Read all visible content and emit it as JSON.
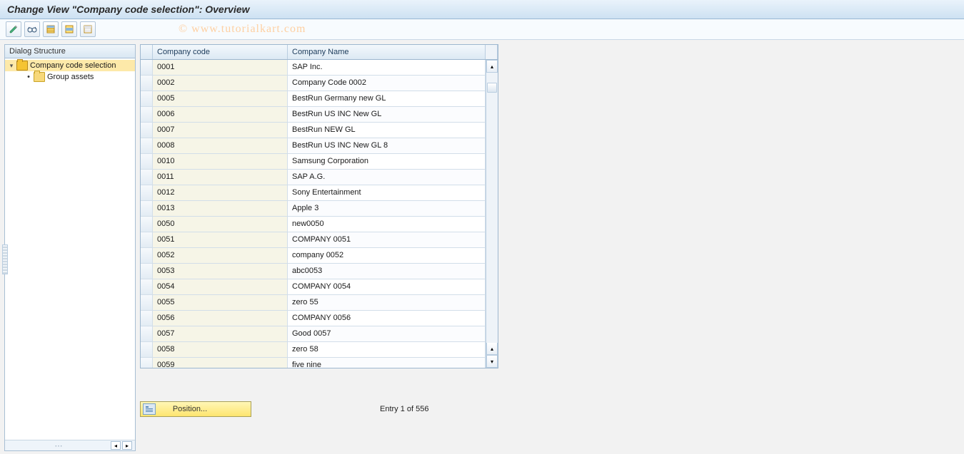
{
  "title": "Change View \"Company code selection\": Overview",
  "watermark": "© www.tutorialkart.com",
  "toolbar": {
    "btn1_tip": "Display/Change",
    "btn2_tip": "Change",
    "btn3_tip": "Select All",
    "btn4_tip": "Select Block",
    "btn5_tip": "Deselect All"
  },
  "dialog_structure": {
    "header": "Dialog Structure",
    "items": [
      {
        "label": "Company code selection",
        "selected": true,
        "expanded": true,
        "leaf": false
      },
      {
        "label": "Group assets",
        "selected": false,
        "expanded": false,
        "leaf": true
      }
    ]
  },
  "table": {
    "columns": {
      "code": "Company code",
      "name": "Company Name"
    },
    "rows": [
      {
        "code": "0001",
        "name": "SAP Inc."
      },
      {
        "code": "0002",
        "name": "Company Code 0002"
      },
      {
        "code": "0005",
        "name": "BestRun Germany new GL"
      },
      {
        "code": "0006",
        "name": "BestRun US INC New GL"
      },
      {
        "code": "0007",
        "name": "BestRun NEW GL"
      },
      {
        "code": "0008",
        "name": "BestRun US INC New GL 8"
      },
      {
        "code": "0010",
        "name": "Samsung Corporation"
      },
      {
        "code": "0011",
        "name": "SAP A.G."
      },
      {
        "code": "0012",
        "name": "Sony Entertainment"
      },
      {
        "code": "0013",
        "name": "Apple 3"
      },
      {
        "code": "0050",
        "name": "new0050"
      },
      {
        "code": "0051",
        "name": "COMPANY 0051"
      },
      {
        "code": "0052",
        "name": "company 0052"
      },
      {
        "code": "0053",
        "name": "abc0053"
      },
      {
        "code": "0054",
        "name": "COMPANY 0054"
      },
      {
        "code": "0055",
        "name": "zero 55"
      },
      {
        "code": "0056",
        "name": "COMPANY 0056"
      },
      {
        "code": "0057",
        "name": "Good 0057"
      },
      {
        "code": "0058",
        "name": "zero 58"
      },
      {
        "code": "0059",
        "name": "five nine"
      }
    ]
  },
  "footer": {
    "position_label": "Position...",
    "entry_text": "Entry 1 of 556"
  }
}
